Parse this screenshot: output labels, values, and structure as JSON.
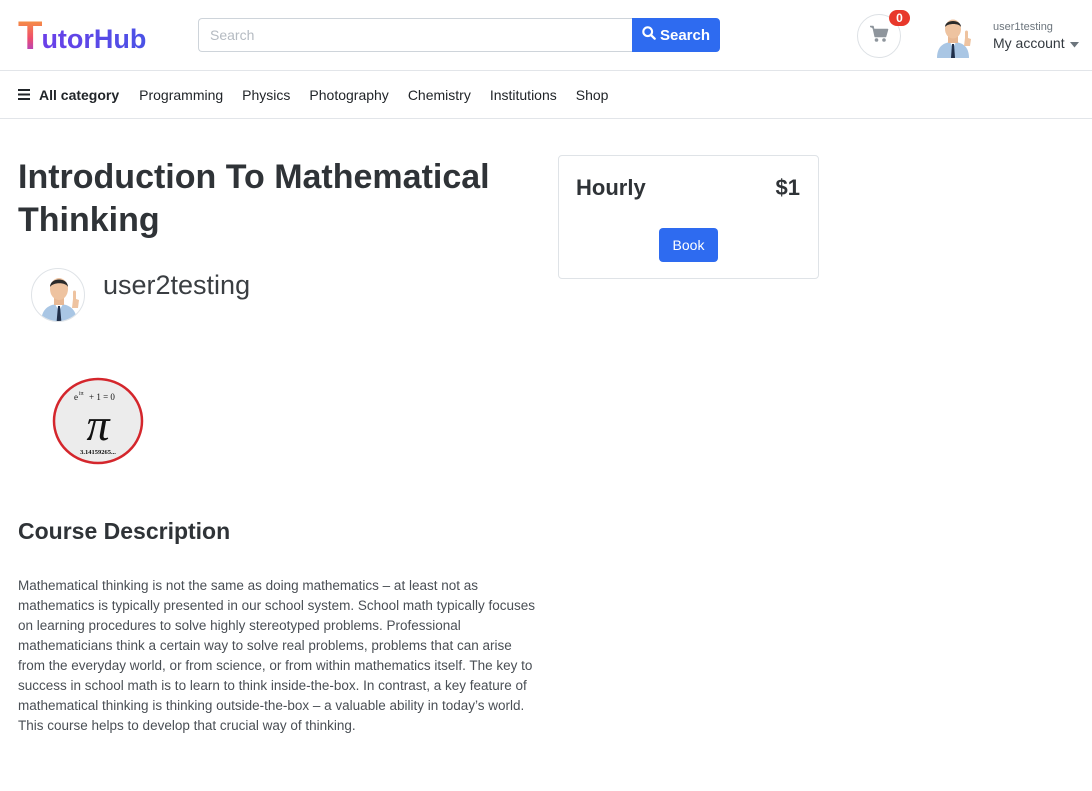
{
  "brand": {
    "logo_first": "T",
    "logo_rest": "utorHub"
  },
  "search": {
    "placeholder": "Search",
    "value": "",
    "button_label": "Search"
  },
  "cart": {
    "count": "0"
  },
  "account": {
    "username": "user1testing",
    "label": "My account"
  },
  "categories": {
    "all_label": "All category",
    "items": [
      "Programming",
      "Physics",
      "Photography",
      "Chemistry",
      "Institutions",
      "Shop"
    ]
  },
  "course": {
    "title": "Introduction To Mathematical Thinking",
    "tutor_name": "user2testing",
    "image": {
      "formula_left": "e",
      "formula_sup": "iπ",
      "formula_right": "+ 1 = 0",
      "symbol": "π",
      "digits": "3.14159265..."
    },
    "description_heading": "Course Description",
    "description": "Mathematical thinking is not the same as doing mathematics – at least not as mathematics is typically presented in our school system. School math typically focuses on learning procedures to solve highly stereotyped problems. Professional mathematicians think a certain way to solve real problems, problems that can arise from the everyday world, or from science, or from within mathematics itself. The key to success in school math is to learn to think inside-the-box. In contrast, a key feature of mathematical thinking is thinking outside-the-box – a valuable ability in today’s world. This course helps to develop that crucial way of thinking."
  },
  "pricing": {
    "type": "Hourly",
    "amount": "$1",
    "book_label": "Book"
  },
  "colors": {
    "primary": "#2e6bf0",
    "badge": "#e8382b",
    "logo_purple": "#6b3fe8",
    "logo_orange": "#f7a13a"
  }
}
